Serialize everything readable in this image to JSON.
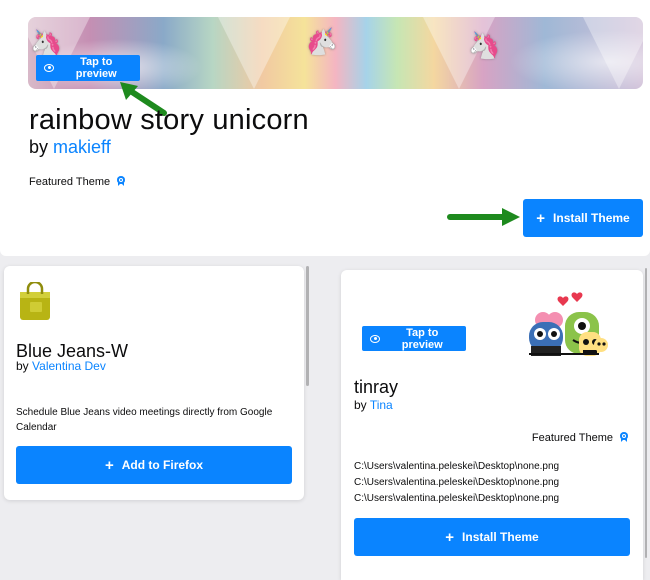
{
  "top_theme": {
    "preview_label": "Tap to preview",
    "title": "rainbow story unicorn",
    "by_prefix": "by",
    "author": "makieff",
    "featured_label": "Featured Theme",
    "install_label": "Install Theme"
  },
  "extension_card": {
    "name": "Blue Jeans-W",
    "by_prefix": "by",
    "author": "Valentina Dev",
    "description": "Schedule Blue Jeans video meetings directly from Google Calendar",
    "add_label": "Add to Firefox"
  },
  "theme_card": {
    "preview_label": "Tap to preview",
    "name": "tinray",
    "by_prefix": "by",
    "author": "Tina",
    "featured_label": "Featured Theme",
    "paths": [
      "C:\\Users\\valentina.peleskei\\Desktop\\none.png",
      "C:\\Users\\valentina.peleskei\\Desktop\\none.png",
      "C:\\Users\\valentina.peleskei\\Desktop\\none.png"
    ],
    "install_label": "Install Theme"
  },
  "colors": {
    "accent": "#0a84ff",
    "annotation_arrow": "#1e8a1e",
    "page_bg": "#ededf0"
  },
  "icons": [
    "eye-icon",
    "featured-badge-icon",
    "plus-icon",
    "shopping-bag-icon",
    "annotation-arrow"
  ]
}
